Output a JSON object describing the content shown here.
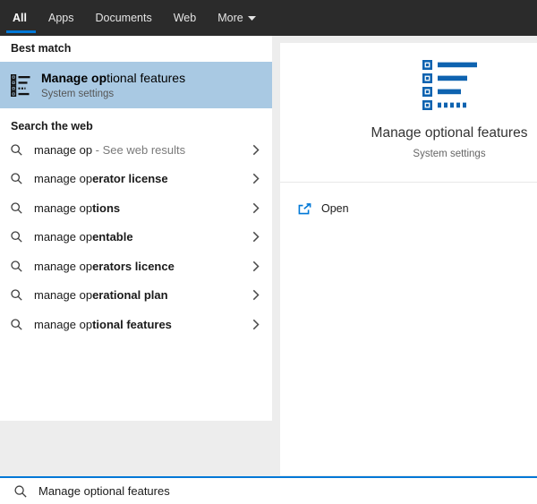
{
  "tabs": {
    "items": [
      {
        "label": "All",
        "active": true
      },
      {
        "label": "Apps",
        "active": false
      },
      {
        "label": "Documents",
        "active": false
      },
      {
        "label": "Web",
        "active": false
      },
      {
        "label": "More",
        "active": false,
        "has_dropdown": true
      }
    ]
  },
  "best_match": {
    "section_label": "Best match",
    "title_bold": "Manage op",
    "title_rest": "tional features",
    "subtitle": "System settings"
  },
  "search_web": {
    "section_label": "Search the web",
    "items": [
      {
        "typed": "manage op",
        "completion": "",
        "annotation": " - See web results"
      },
      {
        "typed": "manage op",
        "completion": "erator license",
        "annotation": ""
      },
      {
        "typed": "manage op",
        "completion": "tions",
        "annotation": ""
      },
      {
        "typed": "manage op",
        "completion": "entable",
        "annotation": ""
      },
      {
        "typed": "manage op",
        "completion": "erators licence",
        "annotation": ""
      },
      {
        "typed": "manage op",
        "completion": "erational plan",
        "annotation": ""
      },
      {
        "typed": "manage op",
        "completion": "tional features",
        "annotation": ""
      }
    ]
  },
  "preview": {
    "title": "Manage optional features",
    "subtitle": "System settings",
    "open_label": "Open"
  },
  "search_bar": {
    "value": "Manage optional features"
  },
  "icons": {
    "best_match_icon": "checkbox-list",
    "preview_icon": "checkbox-list",
    "suggestion_icon": "magnifier",
    "row_chevron": "chevron-right",
    "open_icon": "open-external",
    "more_dropdown": "triangle-down",
    "search_icon": "magnifier"
  },
  "colors": {
    "accent": "#0078d7",
    "highlight_bg": "#a9c9e3",
    "icon_blue": "#0e63b0",
    "tabbar_bg": "#2b2b2b",
    "window_bg": "#ededed"
  }
}
